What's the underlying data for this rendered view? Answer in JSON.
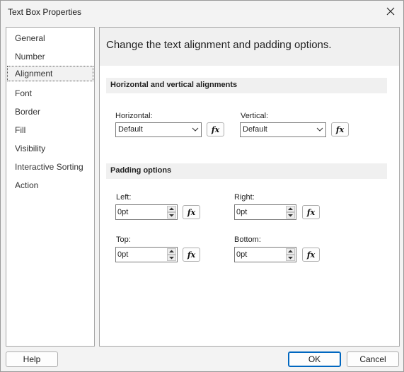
{
  "window": {
    "title": "Text Box Properties"
  },
  "nav": {
    "items": [
      {
        "label": "General"
      },
      {
        "label": "Number"
      },
      {
        "label": "Alignment"
      },
      {
        "label": "Font"
      },
      {
        "label": "Border"
      },
      {
        "label": "Fill"
      },
      {
        "label": "Visibility"
      },
      {
        "label": "Interactive Sorting"
      },
      {
        "label": "Action"
      }
    ],
    "selected": "Alignment"
  },
  "panel": {
    "header": "Change the text alignment and padding options.",
    "alignment": {
      "section_title": "Horizontal and vertical alignments",
      "horizontal_label": "Horizontal:",
      "horizontal_value": "Default",
      "vertical_label": "Vertical:",
      "vertical_value": "Default"
    },
    "padding": {
      "section_title": "Padding options",
      "left_label": "Left:",
      "left_value": "0pt",
      "right_label": "Right:",
      "right_value": "0pt",
      "top_label": "Top:",
      "top_value": "0pt",
      "bottom_label": "Bottom:",
      "bottom_value": "0pt"
    },
    "fx_label": "fx"
  },
  "footer": {
    "help_label": "Help",
    "ok_label": "OK",
    "cancel_label": "Cancel"
  },
  "icons": {
    "close": "close-icon",
    "dropdown": "chevron-down-icon",
    "spin_up": "spin-up-icon",
    "spin_down": "spin-down-icon"
  }
}
